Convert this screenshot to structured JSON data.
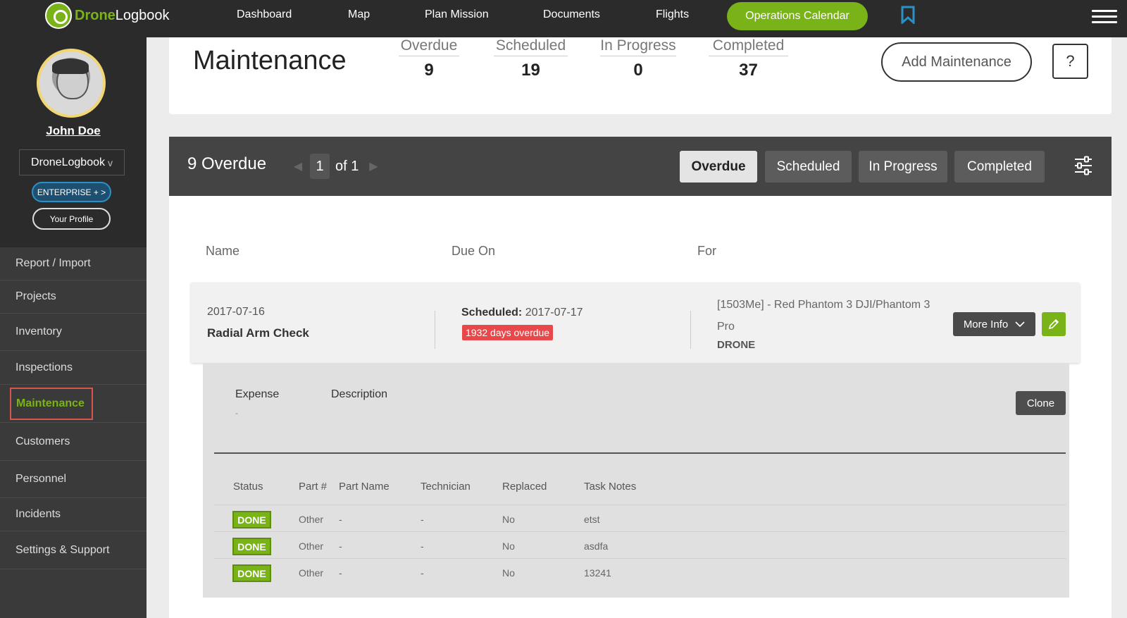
{
  "app": {
    "brand_part1": "Drone",
    "brand_part2": "Logbook",
    "accent_color": "#7ab317"
  },
  "topnav": {
    "items": [
      "Dashboard",
      "Map",
      "Plan Mission",
      "Documents",
      "Flights"
    ],
    "ops_calendar": "Operations Calendar",
    "icons": {
      "bookmark": "bookmark-icon",
      "menu": "hamburger-menu-icon"
    }
  },
  "sidebar": {
    "user_name": "John Doe",
    "org": "DroneLogbook",
    "org_chevron": "v",
    "enterprise_label": "ENTERPRISE + >",
    "profile_label": "Your Profile",
    "menu": [
      "Report / Import",
      "Projects",
      "Inventory",
      "Inspections",
      "Maintenance",
      "Customers",
      "Personnel",
      "Incidents",
      "Settings & Support"
    ],
    "active_item": "Maintenance"
  },
  "header": {
    "title": "Maintenance",
    "stats": [
      {
        "label": "Overdue",
        "value": "9"
      },
      {
        "label": "Scheduled",
        "value": "19"
      },
      {
        "label": "In Progress",
        "value": "0"
      },
      {
        "label": "Completed",
        "value": "37"
      }
    ],
    "add_button": "Add Maintenance",
    "help_button": "?"
  },
  "list": {
    "count_label": "9 Overdue",
    "pager": {
      "current": "1",
      "of": "of 1"
    },
    "tabs": [
      "Overdue",
      "Scheduled",
      "In Progress",
      "Completed"
    ],
    "active_tab": "Overdue",
    "columns": [
      "Name",
      "Due On",
      "For"
    ]
  },
  "record": {
    "date": "2017-07-16",
    "name": "Radial Arm Check",
    "scheduled_label": "Scheduled:",
    "scheduled_date": "2017-07-17",
    "overdue_badge": "1932 days overdue",
    "for_text": "[1503Me] - Red Phantom 3 DJI/Phantom 3 Pro",
    "type": "DRONE",
    "more_info": "More Info",
    "overdue_color": "#e8484a"
  },
  "detail": {
    "expense_label": "Expense",
    "expense_value": "-",
    "description_label": "Description",
    "clone_label": "Clone",
    "task_headers": [
      "Status",
      "Part #",
      "Part Name",
      "Technician",
      "Replaced",
      "Task Notes"
    ],
    "tasks": [
      {
        "status": "DONE",
        "part_no": "Other",
        "part_name": "-",
        "technician": "-",
        "replaced": "No",
        "notes": "etst"
      },
      {
        "status": "DONE",
        "part_no": "Other",
        "part_name": "-",
        "technician": "-",
        "replaced": "No",
        "notes": "asdfa"
      },
      {
        "status": "DONE",
        "part_no": "Other",
        "part_name": "-",
        "technician": "-",
        "replaced": "No",
        "notes": "13241"
      }
    ]
  }
}
